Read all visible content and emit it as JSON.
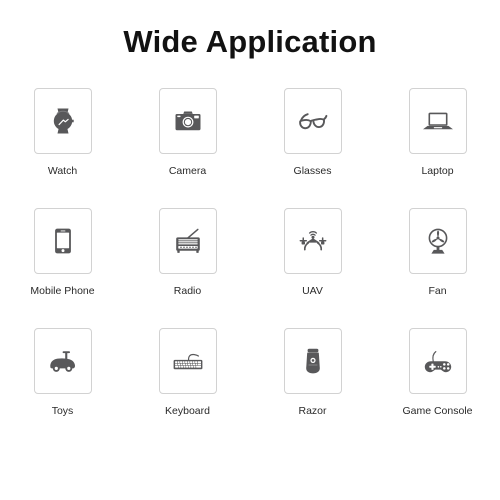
{
  "header": {
    "title": "Wide Application"
  },
  "colors": {
    "background": "#ffffff",
    "title_text": "#121212",
    "label_text": "#2a2a2a",
    "card_border": "#d2d2d2",
    "icon_gray": "#58585a"
  },
  "grid": {
    "columns": 4,
    "rows": 3,
    "items": [
      {
        "label": "Watch",
        "icon": "watch-icon"
      },
      {
        "label": "Camera",
        "icon": "camera-icon"
      },
      {
        "label": "Glasses",
        "icon": "glasses-icon"
      },
      {
        "label": "Laptop",
        "icon": "laptop-icon"
      },
      {
        "label": "Mobile Phone",
        "icon": "mobile-phone-icon"
      },
      {
        "label": "Radio",
        "icon": "radio-icon"
      },
      {
        "label": "UAV",
        "icon": "uav-drone-icon"
      },
      {
        "label": "Fan",
        "icon": "fan-icon"
      },
      {
        "label": "Toys",
        "icon": "toy-car-icon"
      },
      {
        "label": "Keyboard",
        "icon": "keyboard-icon"
      },
      {
        "label": "Razor",
        "icon": "razor-icon"
      },
      {
        "label": "Game Console",
        "icon": "gamepad-icon"
      }
    ]
  }
}
